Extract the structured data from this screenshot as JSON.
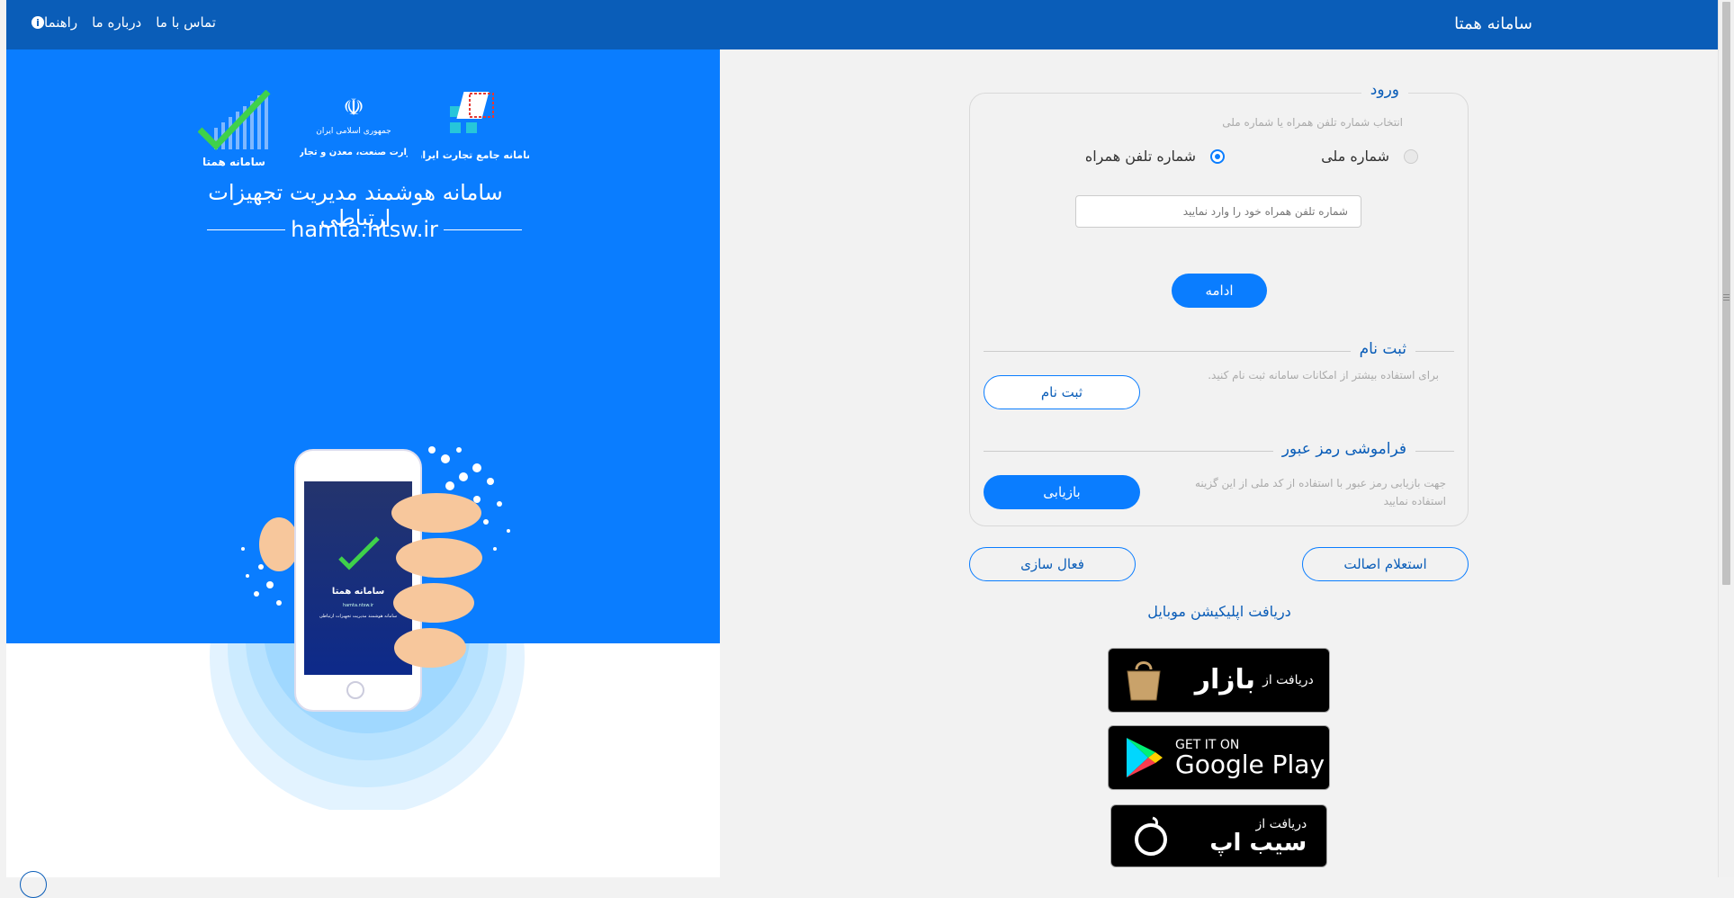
{
  "header": {
    "brand": "سامانه همتا",
    "nav": {
      "contact": "تماس با ما",
      "about": "درباره ما",
      "help": "راهنما",
      "help_icon": "info-icon"
    }
  },
  "hero": {
    "logo_hamta_text": "سامانه همتا",
    "logo_ministry_line1": "جمهوری اسلامی ایران",
    "logo_ministry_line2": "وزارت صنعت، معدن و تجارت",
    "logo_trade_text": "سامانه جامع تجارت ایران",
    "slogan": "سامانه هوشمند مدیریت تجهیزات ارتباطی",
    "url": "hamta.ntsw.ir",
    "phone_screen_title": "سامانه همتا",
    "phone_screen_url": "hamta.ntsw.ir",
    "phone_screen_subtitle": "سامانه هوشمند مدیریت تجهیزات ارتباطی"
  },
  "login": {
    "legend": "ورود",
    "hint": "انتخاب شماره تلفن همراه یا شماره ملی",
    "options": {
      "national": "شماره ملی",
      "mobile": "شماره تلفن همراه",
      "selected": "mobile"
    },
    "input_placeholder": "شماره تلفن همراه خود را وارد نمایید",
    "input_value": "",
    "continue": "ادامه"
  },
  "register": {
    "title": "ثبت نام",
    "desc": "برای استفاده بیشتر از امکانات سامانه ثبت نام کنید.",
    "button": "ثبت نام"
  },
  "forgot": {
    "title": "فراموشی رمز عبور",
    "desc": "جهت بازیابی رمز عبور با استفاده از کد ملی از این گزینه استفاده نمایید",
    "button": "بازیابی"
  },
  "actions": {
    "authenticity": "استعلام اصالت",
    "activate": "فعال سازی"
  },
  "apps": {
    "title": "دریافت اپلیکیشن موبایل",
    "bazaar": {
      "small": "دریافت از",
      "big": "بازار",
      "icon": "bazaar-bag-icon"
    },
    "google": {
      "small": "GET IT ON",
      "big": "Google Play",
      "icon": "google-play-icon"
    },
    "sibapp": {
      "small": "دریافت از",
      "big": "سیب اپ",
      "icon": "sibapp-icon"
    }
  },
  "colors": {
    "topbar": "#0a5db8",
    "hero": "#0a7dff",
    "accent": "#0a7dff",
    "text_accent": "#0a5db8"
  }
}
